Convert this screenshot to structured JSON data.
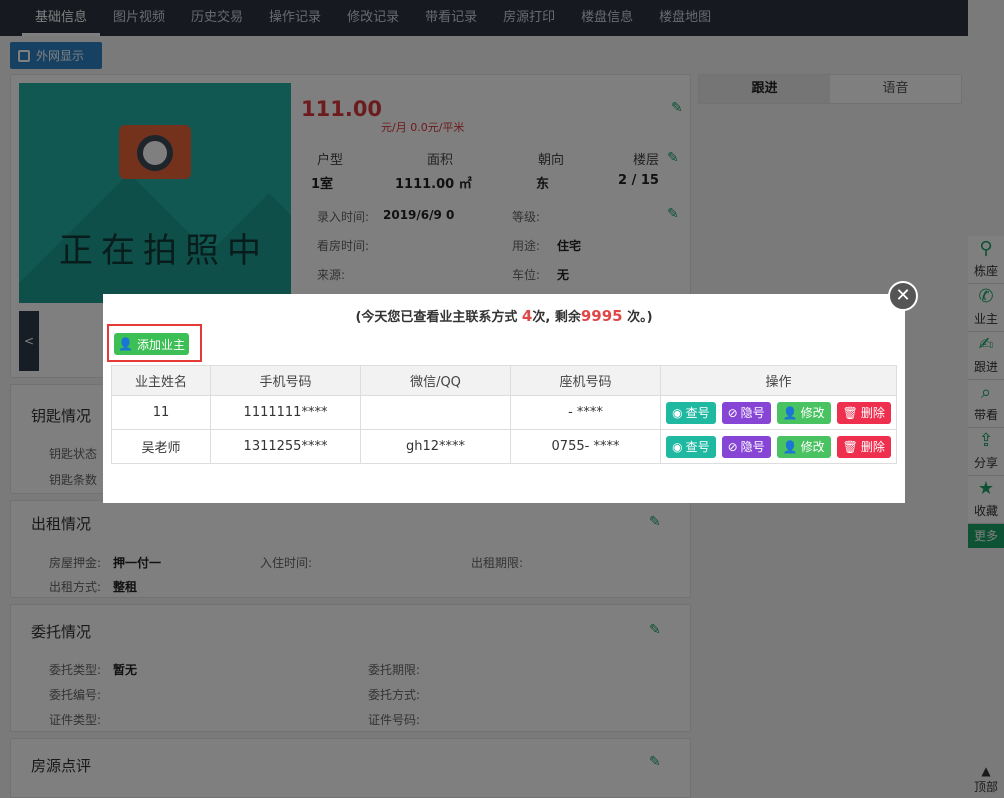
{
  "topnav": {
    "tabs": [
      "基础信息",
      "图片视频",
      "历史交易",
      "操作记录",
      "修改记录",
      "带看记录",
      "房源打印",
      "楼盘信息",
      "楼盘地图"
    ]
  },
  "ext_button": "外网显示",
  "listing": {
    "price": "111.00",
    "price_unit_a": "元/月",
    "price_unit_b": "0.0",
    "price_unit_c": "元/平米",
    "grid_labels": [
      "户型",
      "面积",
      "朝向",
      "楼层"
    ],
    "grid_values": [
      "1室",
      "1111.00 ㎡",
      "东",
      "2 / 15"
    ],
    "entry_time_label": "录入时间:",
    "entry_time_value": "2019/6/9 0",
    "grade_label": "等级:",
    "view_time_label": "看房时间:",
    "usage_label": "用途:",
    "usage_value": "住宅",
    "source_label": "来源:",
    "parking_label": "车位:",
    "parking_value": "无",
    "prev_arrow": "<"
  },
  "photo_text": "正在拍照中",
  "sections": {
    "key_title": "钥匙情况",
    "key_status": "钥匙状态",
    "key_count": "钥匙条数",
    "rent_title": "出租情况",
    "rent_deposit_label": "房屋押金:",
    "rent_deposit_value": "押一付一",
    "rent_checkin_label": "入住时间:",
    "rent_period_label": "出租期限:",
    "rent_mode_label": "出租方式:",
    "rent_mode_value": "整租",
    "entrust_title": "委托情况",
    "entrust_type_label": "委托类型:",
    "entrust_type_value": "暂无",
    "entrust_period_label": "委托期限:",
    "entrust_no_label": "委托编号:",
    "entrust_method_label": "委托方式:",
    "cert_type_label": "证件类型:",
    "cert_no_label": "证件号码:",
    "review_title": "房源点评"
  },
  "right_tabs": [
    "跟进",
    "语音"
  ],
  "sidebar": [
    "栋座",
    "业主",
    "跟进",
    "带看",
    "分享",
    "收藏"
  ],
  "sidebar_more": "更多",
  "sidebar_top": "顶部",
  "modal": {
    "notice_pre": "(今天您已查看业主联系方式 ",
    "viewed_count": "4",
    "notice_mid": "次, 剩余",
    "remaining_count": "9995",
    "notice_post": " 次。)",
    "add_owner": "添加业主",
    "columns": [
      "业主姓名",
      "手机号码",
      "微信/QQ",
      "座机号码",
      "操作"
    ],
    "rows": [
      {
        "name": "11",
        "mobile": "1111111****",
        "wechat": "",
        "landline": "- ****"
      },
      {
        "name": "吴老师",
        "mobile": "1311255****",
        "wechat": "gh12****",
        "landline": "0755- ****"
      }
    ],
    "actions": {
      "view": "查号",
      "hide": "隐号",
      "edit": "修改",
      "delete": "删除"
    },
    "close": "✕"
  },
  "colors": {
    "accent_green": "#1aa567",
    "price_red": "#d9383a",
    "view_teal": "#1fb8a1",
    "hide_purple": "#8745d6",
    "edit_green": "#49c361",
    "delete_red": "#ef2f4e",
    "highlight_red": "#e53935"
  }
}
